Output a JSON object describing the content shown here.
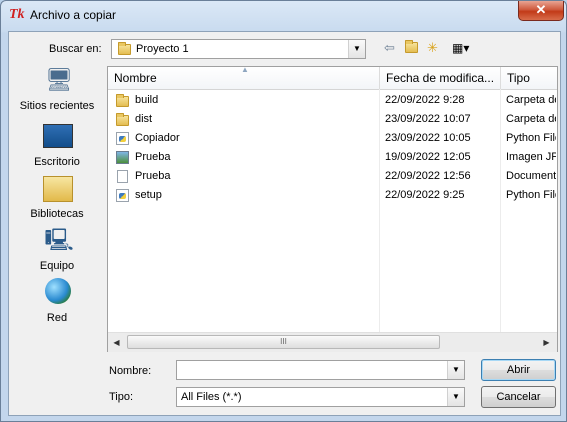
{
  "window": {
    "title": "Archivo a copiar",
    "close_label": "✕"
  },
  "toolbar": {
    "look_in_label": "Buscar en:",
    "look_in_value": "Proyecto 1"
  },
  "places": [
    {
      "label": "Sitios recientes",
      "icon": "recent-places-icon"
    },
    {
      "label": "Escritorio",
      "icon": "desktop-icon"
    },
    {
      "label": "Bibliotecas",
      "icon": "libraries-icon"
    },
    {
      "label": "Equipo",
      "icon": "computer-icon"
    },
    {
      "label": "Red",
      "icon": "network-icon"
    }
  ],
  "columns": {
    "name": "Nombre",
    "date": "Fecha de modifica...",
    "type": "Tipo"
  },
  "files": [
    {
      "name": "build",
      "date": "22/09/2022 9:28",
      "type": "Carpeta de archivos",
      "icon": "folder-icon"
    },
    {
      "name": "dist",
      "date": "23/09/2022 10:07",
      "type": "Carpeta de archivos",
      "icon": "folder-icon"
    },
    {
      "name": "Copiador",
      "date": "23/09/2022 10:05",
      "type": "Python File",
      "icon": "python-file-icon"
    },
    {
      "name": "Prueba",
      "date": "19/09/2022 12:05",
      "type": "Imagen JPEG",
      "icon": "image-file-icon"
    },
    {
      "name": "Prueba",
      "date": "22/09/2022 12:56",
      "type": "Documento de texto",
      "icon": "text-file-icon"
    },
    {
      "name": "setup",
      "date": "22/09/2022 9:25",
      "type": "Python File",
      "icon": "python-file-icon"
    }
  ],
  "scroll": {
    "grip": "III"
  },
  "form": {
    "name_label": "Nombre:",
    "name_value": "",
    "type_label": "Tipo:",
    "type_value": "All Files (*.*)"
  },
  "buttons": {
    "open": "Abrir",
    "cancel": "Cancelar"
  }
}
